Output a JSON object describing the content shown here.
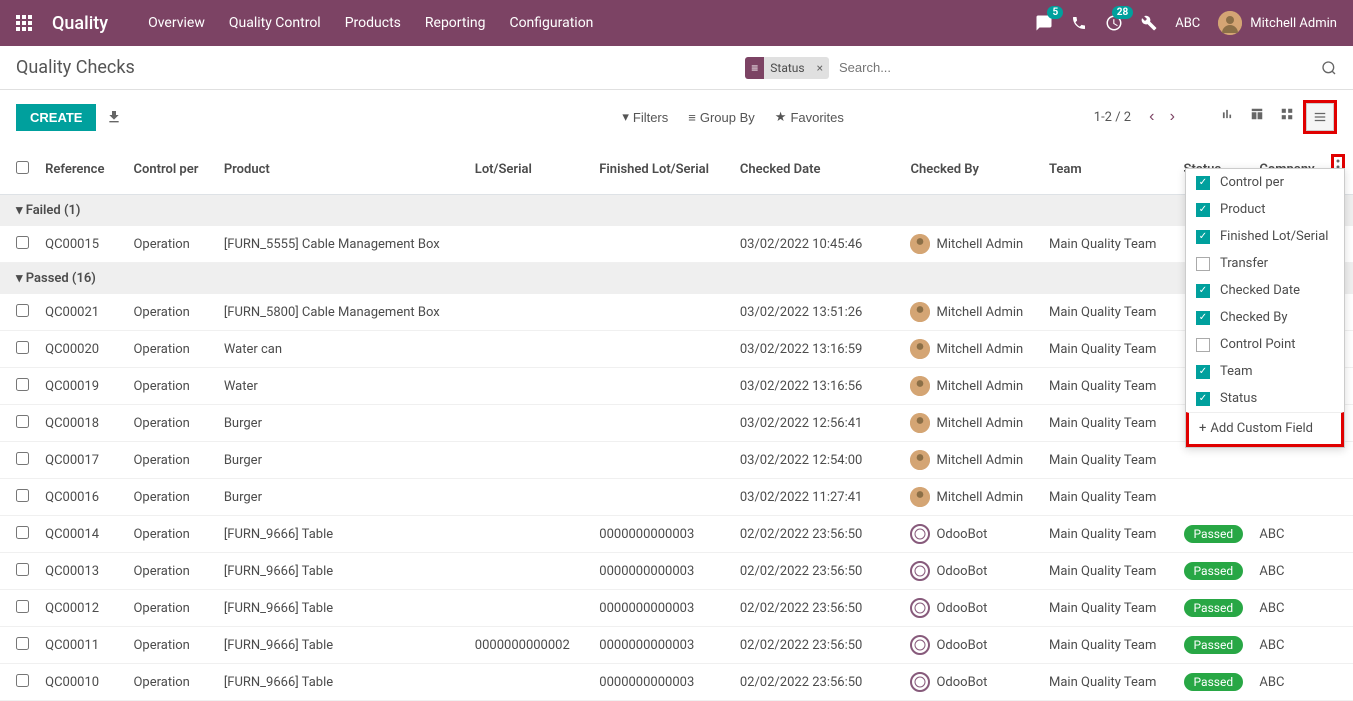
{
  "nav": {
    "brand": "Quality",
    "menu": [
      "Overview",
      "Quality Control",
      "Products",
      "Reporting",
      "Configuration"
    ],
    "msg_badge": "5",
    "activity_badge": "28",
    "company": "ABC",
    "user": "Mitchell Admin"
  },
  "header": {
    "title": "Quality Checks",
    "filter_tag": "Status",
    "search_placeholder": "Search..."
  },
  "controls": {
    "create": "CREATE",
    "filters": "Filters",
    "groupby": "Group By",
    "favorites": "Favorites",
    "pager": "1-2 / 2"
  },
  "columns": {
    "reference": "Reference",
    "control_per": "Control per",
    "product": "Product",
    "lot": "Lot/Serial",
    "finished_lot": "Finished Lot/Serial",
    "checked_date": "Checked Date",
    "checked_by": "Checked By",
    "team": "Team",
    "status": "Status",
    "company": "Company"
  },
  "groups": [
    {
      "label": "Failed (1)",
      "rows": [
        {
          "ref": "QC00015",
          "ctrl": "Operation",
          "prod": "[FURN_5555] Cable Management Box",
          "lot": "",
          "flot": "",
          "date": "03/02/2022 10:45:46",
          "user": "Mitchell Admin",
          "bot": false,
          "team": "Main Quality Team",
          "status": "",
          "co": ""
        }
      ]
    },
    {
      "label": "Passed (16)",
      "rows": [
        {
          "ref": "QC00021",
          "ctrl": "Operation",
          "prod": "[FURN_5800] Cable Management Box",
          "lot": "",
          "flot": "",
          "date": "03/02/2022 13:51:26",
          "user": "Mitchell Admin",
          "bot": false,
          "team": "Main Quality Team",
          "status": "",
          "co": ""
        },
        {
          "ref": "QC00020",
          "ctrl": "Operation",
          "prod": "Water can",
          "lot": "",
          "flot": "",
          "date": "03/02/2022 13:16:59",
          "user": "Mitchell Admin",
          "bot": false,
          "team": "Main Quality Team",
          "status": "",
          "co": ""
        },
        {
          "ref": "QC00019",
          "ctrl": "Operation",
          "prod": "Water",
          "lot": "",
          "flot": "",
          "date": "03/02/2022 13:16:56",
          "user": "Mitchell Admin",
          "bot": false,
          "team": "Main Quality Team",
          "status": "",
          "co": ""
        },
        {
          "ref": "QC00018",
          "ctrl": "Operation",
          "prod": "Burger",
          "lot": "",
          "flot": "",
          "date": "03/02/2022 12:56:41",
          "user": "Mitchell Admin",
          "bot": false,
          "team": "Main Quality Team",
          "status": "",
          "co": ""
        },
        {
          "ref": "QC00017",
          "ctrl": "Operation",
          "prod": "Burger",
          "lot": "",
          "flot": "",
          "date": "03/02/2022 12:54:00",
          "user": "Mitchell Admin",
          "bot": false,
          "team": "Main Quality Team",
          "status": "",
          "co": ""
        },
        {
          "ref": "QC00016",
          "ctrl": "Operation",
          "prod": "Burger",
          "lot": "",
          "flot": "",
          "date": "03/02/2022 11:27:41",
          "user": "Mitchell Admin",
          "bot": false,
          "team": "Main Quality Team",
          "status": "",
          "co": ""
        },
        {
          "ref": "QC00014",
          "ctrl": "Operation",
          "prod": "[FURN_9666] Table",
          "lot": "",
          "flot": "0000000000003",
          "date": "02/02/2022 23:56:50",
          "user": "OdooBot",
          "bot": true,
          "team": "Main Quality Team",
          "status": "Passed",
          "co": "ABC"
        },
        {
          "ref": "QC00013",
          "ctrl": "Operation",
          "prod": "[FURN_9666] Table",
          "lot": "",
          "flot": "0000000000003",
          "date": "02/02/2022 23:56:50",
          "user": "OdooBot",
          "bot": true,
          "team": "Main Quality Team",
          "status": "Passed",
          "co": "ABC"
        },
        {
          "ref": "QC00012",
          "ctrl": "Operation",
          "prod": "[FURN_9666] Table",
          "lot": "",
          "flot": "0000000000003",
          "date": "02/02/2022 23:56:50",
          "user": "OdooBot",
          "bot": true,
          "team": "Main Quality Team",
          "status": "Passed",
          "co": "ABC"
        },
        {
          "ref": "QC00011",
          "ctrl": "Operation",
          "prod": "[FURN_9666] Table",
          "lot": "0000000000002",
          "flot": "0000000000003",
          "date": "02/02/2022 23:56:50",
          "user": "OdooBot",
          "bot": true,
          "team": "Main Quality Team",
          "status": "Passed",
          "co": "ABC"
        },
        {
          "ref": "QC00010",
          "ctrl": "Operation",
          "prod": "[FURN_9666] Table",
          "lot": "",
          "flot": "0000000000003",
          "date": "02/02/2022 23:56:50",
          "user": "OdooBot",
          "bot": true,
          "team": "Main Quality Team",
          "status": "Passed",
          "co": "ABC"
        }
      ]
    }
  ],
  "dropdown": {
    "items": [
      {
        "label": "Control per",
        "checked": true
      },
      {
        "label": "Product",
        "checked": true
      },
      {
        "label": "Finished Lot/Serial",
        "checked": true
      },
      {
        "label": "Transfer",
        "checked": false
      },
      {
        "label": "Checked Date",
        "checked": true
      },
      {
        "label": "Checked By",
        "checked": true
      },
      {
        "label": "Control Point",
        "checked": false
      },
      {
        "label": "Team",
        "checked": true
      },
      {
        "label": "Status",
        "checked": true
      }
    ],
    "add_custom": "Add Custom Field"
  }
}
